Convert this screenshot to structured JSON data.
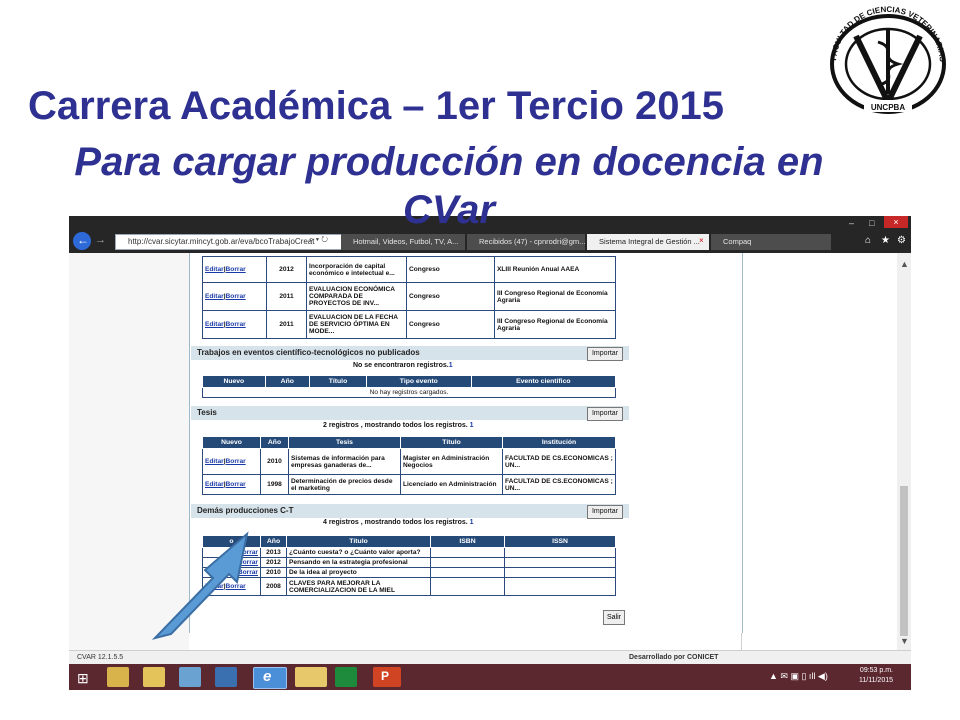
{
  "slide": {
    "title": "Carrera Académica – 1er Tercio 2015",
    "subtitle": "Para cargar producción en docencia en CVar"
  },
  "logo": {
    "text": "FACULTAD DE CIENCIAS VETERINARIAS",
    "bottom_text": "UNCPBA"
  },
  "browser": {
    "url": "http://cvar.sicytar.mincyt.gob.ar/eva/bcoTrabajoCreat",
    "tabs": [
      "Hotmail, Videos, Futbol, TV, A...",
      "Recibidos (47) - cpnrodri@gm...",
      "Sistema Integral de Gestión ...",
      "Compaq"
    ],
    "window_buttons": [
      "–",
      "□",
      "×"
    ]
  },
  "congreso_rows": [
    {
      "edit": "Editar",
      "sep": "|",
      "del": "Borrar",
      "year": "2012",
      "title": "Incorporación de capital económico e intelectual e...",
      "type": "Congreso",
      "event": "XLIII Reunión Anual AAEA"
    },
    {
      "edit": "Editar",
      "sep": "|",
      "del": "Borrar",
      "year": "2011",
      "title": "EVALUACION ECONÓMICA COMPARADA DE PROYECTOS DE INV...",
      "type": "Congreso",
      "event": "III Congreso Regional de Economía Agraria"
    },
    {
      "edit": "Editar",
      "sep": "|",
      "del": "Borrar",
      "year": "2011",
      "title": "EVALUACION DE LA FECHA DE SERVICIO ÓPTIMA EN MODE...",
      "type": "Congreso",
      "event": "III Congreso Regional de Economía Agraria"
    }
  ],
  "sections": {
    "no_publicados": {
      "header": "Trabajos en eventos científico-tecnológicos no publicados",
      "import": "Importar",
      "count": "No se encontraron registros.",
      "count_num": "1",
      "columns": [
        "Nuevo",
        "Año",
        "Título",
        "Tipo evento",
        "Evento científico"
      ],
      "empty": "No hay registros cargados."
    },
    "tesis": {
      "header": "Tesis",
      "import": "Importar",
      "count": "2 registros , mostrando todos los registros.",
      "count_num": "1",
      "columns": [
        "Nuevo",
        "Año",
        "Tesis",
        "Título",
        "Institución"
      ],
      "rows": [
        {
          "edit": "Editar",
          "sep": "|",
          "del": "Borrar",
          "year": "2010",
          "tesis": "Sistemas de información para empresas ganaderas de...",
          "title": "Magister en Administración Negocios",
          "inst": "FACULTAD DE CS.ECONOMICAS ; UN..."
        },
        {
          "edit": "Editar",
          "sep": "|",
          "del": "Borrar",
          "year": "1998",
          "tesis": "Determinación de precios desde el marketing",
          "title": "Licenciado en Administración",
          "inst": "FACULTAD DE CS.ECONOMICAS ; UN..."
        }
      ]
    },
    "demas": {
      "header": "Demás producciones C-T",
      "import": "Importar",
      "count": "4 registros , mostrando todos los registros.",
      "count_num": "1",
      "columns": [
        "o",
        "Año",
        "Título",
        "ISBN",
        "ISSN"
      ],
      "rows": [
        {
          "edit": "",
          "sep": "",
          "del": "Borrar",
          "year": "2013",
          "title": "¿Cuánto cuesta? o ¿Cuánto valor aporta?"
        },
        {
          "edit": "",
          "sep": "",
          "del": "Borrar",
          "year": "2012",
          "title": "Pensando en la estrategia profesional"
        },
        {
          "edit": "",
          "sep": "",
          "del": "Borrar",
          "year": "2010",
          "title": "De la idea al proyecto"
        },
        {
          "edit": "Editar",
          "sep": "|",
          "del": "Borrar",
          "year": "2008",
          "title": "CLAVES PARA MEJORAR LA COMERCIALIZACION DE LA MIEL"
        }
      ]
    }
  },
  "salir": "Salir",
  "status": {
    "version": "CVAR  12.1.5.5",
    "developed": "Desarrollado por CONICET"
  },
  "clock": {
    "time": "09:53 p.m.",
    "date": "11/11/2015"
  },
  "colors": {
    "title": "#2e3192",
    "table_header": "#254a78",
    "arrow": "#5b9bd5",
    "taskbar": "#5b2830"
  }
}
